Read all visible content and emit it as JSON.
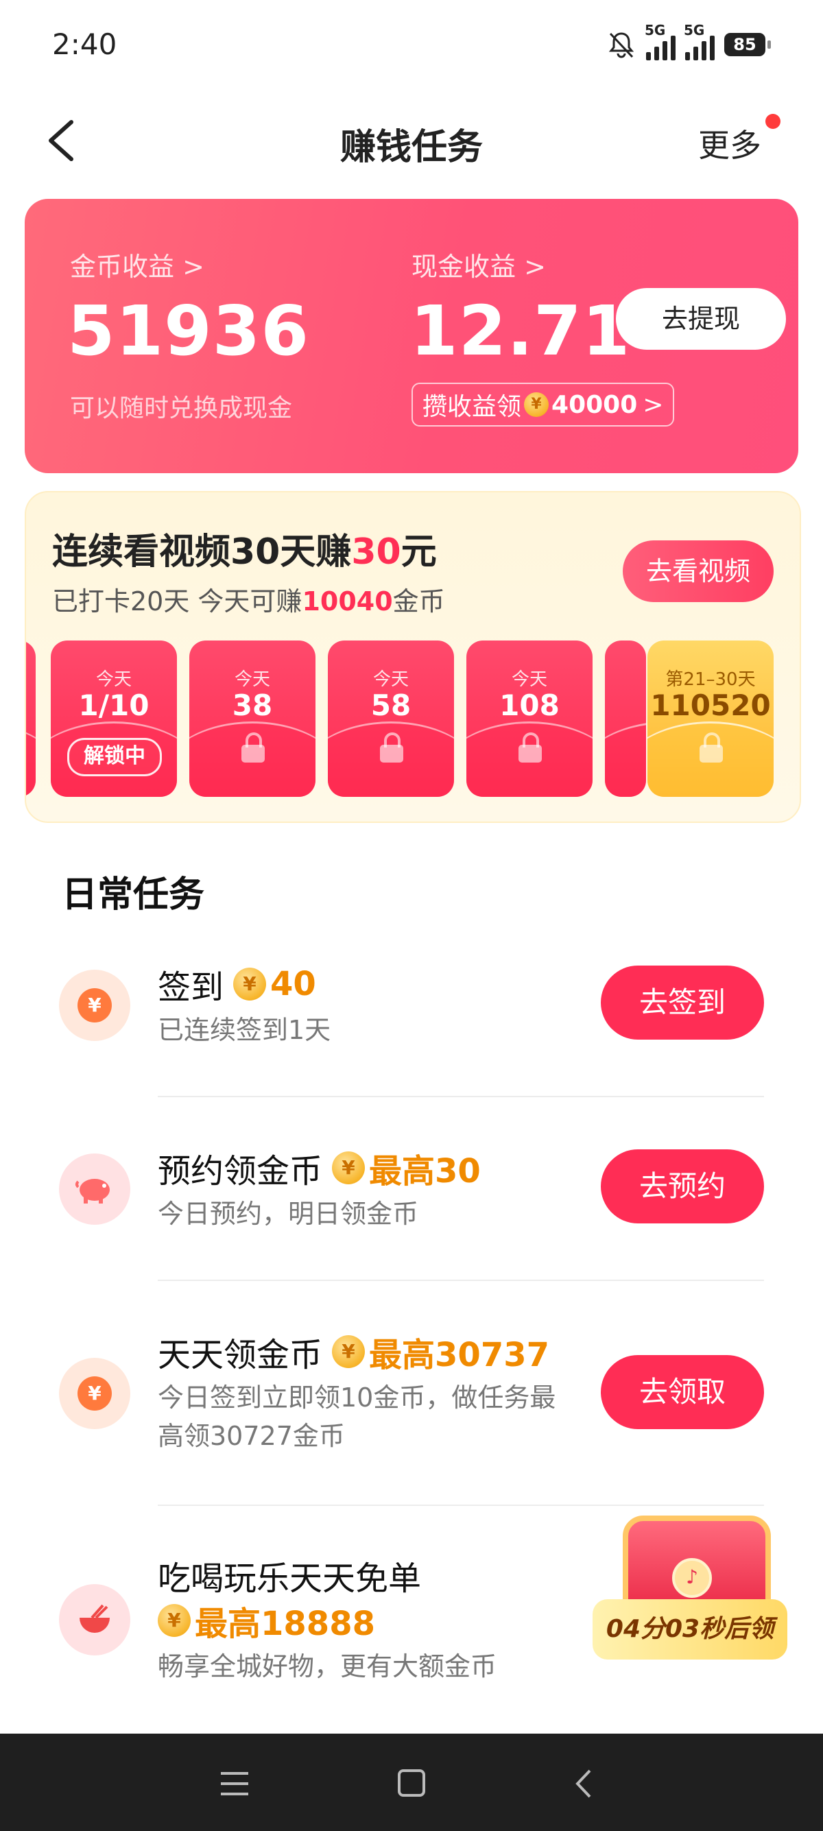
{
  "status": {
    "time": "2:40",
    "battery": "85",
    "net1": "5G",
    "net2": "5G"
  },
  "nav": {
    "title": "赚钱任务",
    "more": "更多"
  },
  "earnings": {
    "coin_label": "金币收益 >",
    "coin_value": "51936",
    "coin_hint": "可以随时兑换成现金",
    "cash_label": "现金收益 >",
    "cash_value": "12.71",
    "withdraw": "去提现",
    "promo_prefix": "攒收益领",
    "promo_amount": "40000",
    "promo_arrow": ">"
  },
  "streak": {
    "title_a": "连续看视频30天赚",
    "title_hl": "30",
    "title_b": "元",
    "sub_a": "已打卡20天 今天可赚",
    "sub_hl": "10040",
    "sub_b": "金币",
    "button": "去看视频",
    "tiles": [
      {
        "label": "今天",
        "value": "1/10",
        "chip": "解锁中"
      },
      {
        "label": "今天",
        "value": "38"
      },
      {
        "label": "今天",
        "value": "58"
      },
      {
        "label": "今天",
        "value": "108"
      }
    ],
    "gold": {
      "label": "第21–30天",
      "value": "110520"
    }
  },
  "daily": {
    "title": "日常任务",
    "tasks": [
      {
        "title": "签到",
        "reward": "40",
        "desc": "已连续签到1天",
        "button": "去签到",
        "icon": "yuan-coin-icon"
      },
      {
        "title": "预约领金币",
        "reward": "最高30",
        "desc": "今日预约，明日领金币",
        "button": "去预约",
        "icon": "piggy-bank-icon"
      },
      {
        "title": "天天领金币",
        "reward": "最高30737",
        "desc": "今日签到立即领10金币，做任务最高领30727金币",
        "button": "去领取",
        "icon": "yuan-coin-icon"
      },
      {
        "title": "吃喝玩乐天天免单",
        "reward": "最高18888",
        "desc": "畅享全城好物，更有大额金币",
        "icon": "bowl-icon"
      }
    ]
  },
  "chest": {
    "timer": "04分03秒后领"
  },
  "colors": {
    "brand": "#ff2d55",
    "reward": "#f08a00",
    "card_gradient": "#ff5277"
  }
}
